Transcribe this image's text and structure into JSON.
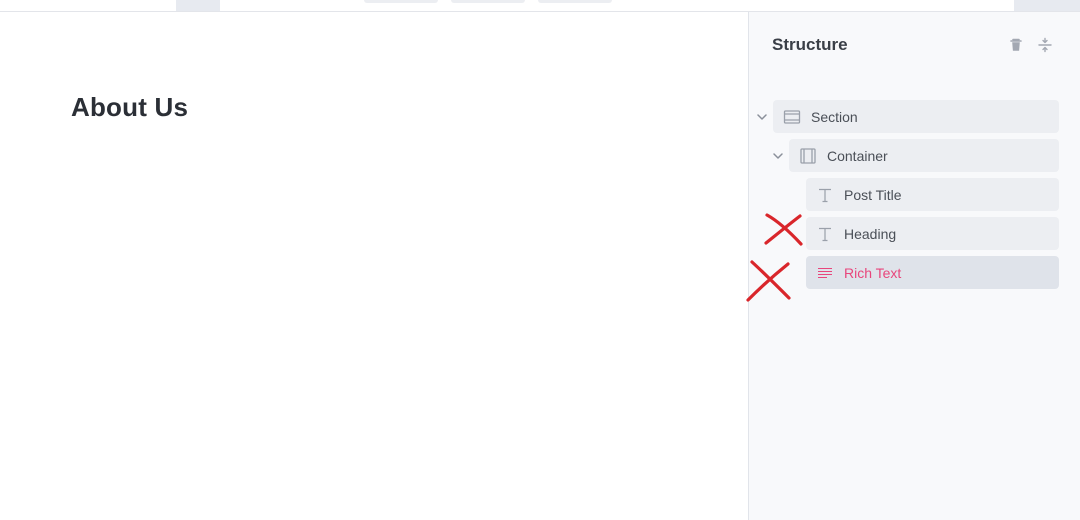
{
  "canvas": {
    "heading": "About Us"
  },
  "structure": {
    "title": "Structure",
    "actions": [
      {
        "name": "delete",
        "icon": "trash-icon"
      },
      {
        "name": "collapse-all",
        "icon": "collapse-icon"
      }
    ],
    "tree": [
      {
        "label": "Section",
        "icon": "section-icon",
        "expanded": true,
        "level": 0
      },
      {
        "label": "Container",
        "icon": "container-icon",
        "expanded": true,
        "level": 1
      },
      {
        "label": "Post Title",
        "icon": "text-icon",
        "level": 2
      },
      {
        "label": "Heading",
        "icon": "text-icon",
        "level": 2
      },
      {
        "label": "Rich Text",
        "icon": "rich-text-icon",
        "level": 2,
        "selected": true
      }
    ]
  },
  "colors": {
    "accent": "#e8467c",
    "annotation": "#d9262b",
    "panel_bg": "#f8f9fb",
    "row_bg": "#eceef2"
  }
}
